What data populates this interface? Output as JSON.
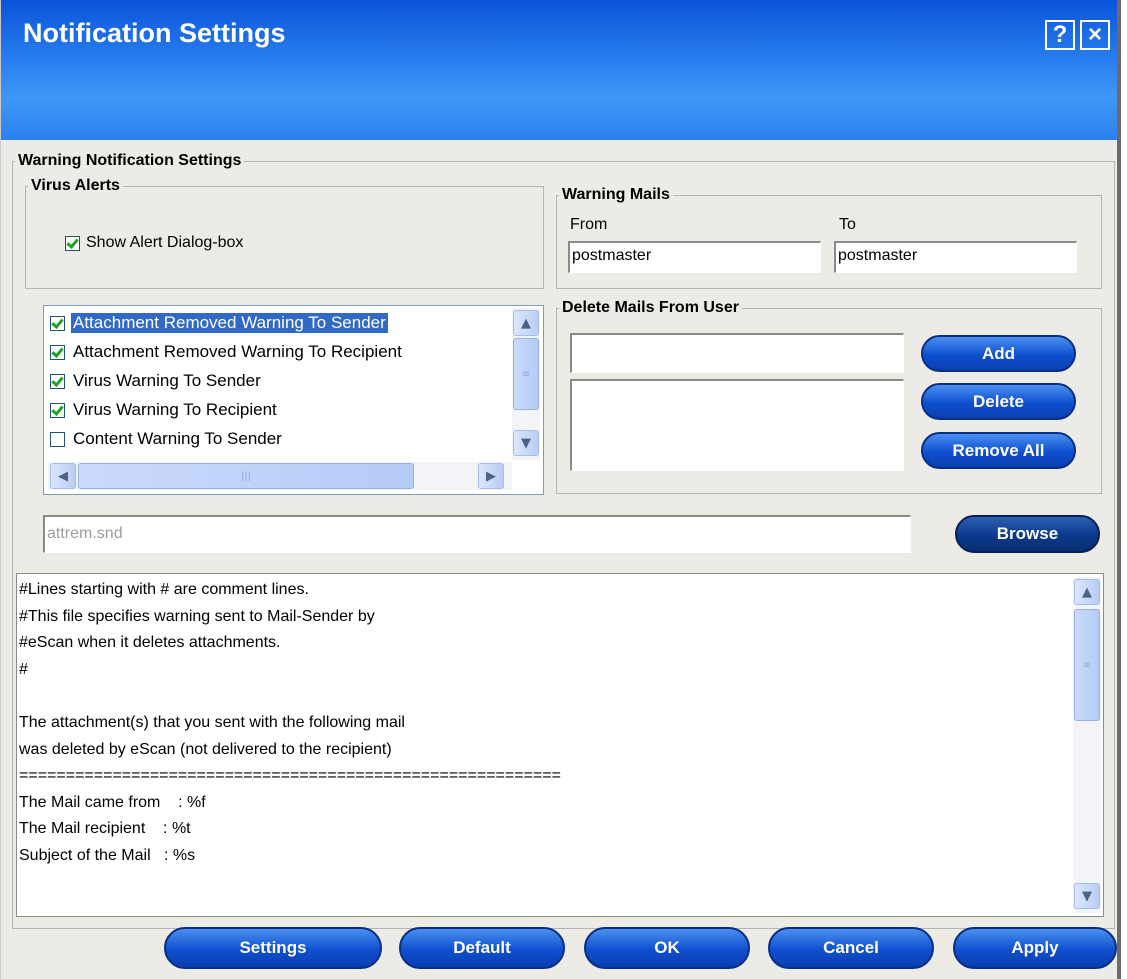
{
  "window": {
    "title": "Notification Settings",
    "help_label": "?",
    "close_label": "×"
  },
  "group": {
    "legend": "Warning Notification Settings",
    "virus_alerts": {
      "legend": "Virus Alerts",
      "show_alert_label": "Show Alert Dialog-box",
      "show_alert_checked": true
    },
    "warning_mails": {
      "legend": "Warning Mails",
      "from_label": "From",
      "to_label": "To",
      "from_value": "postmaster",
      "to_value": "postmaster"
    },
    "delete_mails": {
      "legend": "Delete Mails From User",
      "input_value": "",
      "add_label": "Add",
      "delete_label": "Delete",
      "remove_all_label": "Remove All"
    },
    "warnings_list": [
      {
        "label": "Attachment Removed Warning To Sender",
        "checked": true,
        "selected": true
      },
      {
        "label": "Attachment Removed Warning To Recipient",
        "checked": true,
        "selected": false
      },
      {
        "label": "Virus Warning To Sender",
        "checked": true,
        "selected": false
      },
      {
        "label": "Virus Warning To Recipient",
        "checked": true,
        "selected": false
      },
      {
        "label": "Content Warning To Sender",
        "checked": false,
        "selected": false
      }
    ],
    "file_path": "attrem.snd",
    "browse_label": "Browse",
    "editor_lines": [
      "#Lines starting with # are comment lines.",
      "#This file specifies warning sent to Mail-Sender by",
      "#eScan when it deletes attachments.",
      "#",
      "",
      "The attachment(s) that you sent with the following mail",
      "was deleted by eScan (not delivered to the recipient)",
      "==========================================================",
      "The Mail came from    : %f",
      "The Mail recipient    : %t",
      "Subject of the Mail   : %s"
    ]
  },
  "footer": {
    "settings_label": "Settings",
    "default_label": "Default",
    "ok_label": "OK",
    "cancel_label": "Cancel",
    "apply_label": "Apply"
  },
  "icons": {
    "scroll_up": "chevron-up-icon",
    "scroll_down": "chevron-down-icon",
    "scroll_left": "chevron-left-icon",
    "scroll_right": "chevron-right-icon"
  },
  "colors": {
    "titlebar": "#1f6fe6",
    "button": "#0f4fcf",
    "selection": "#316ac5",
    "check": "#21a121"
  }
}
